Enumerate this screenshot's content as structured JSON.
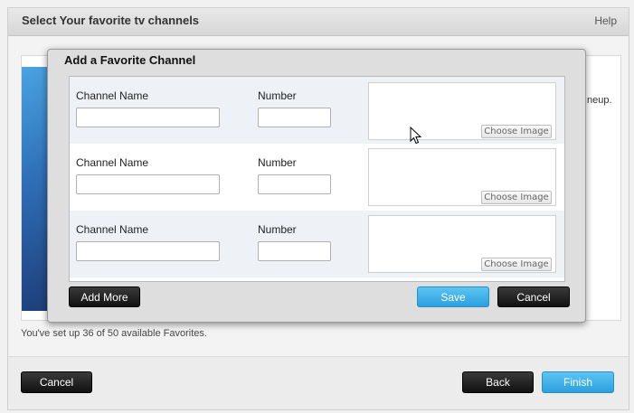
{
  "wizard": {
    "title": "Select Your favorite tv channels",
    "help_label": "Help",
    "side_text": "neup.",
    "status_text": "You've set up 36 of 50 available Favorites.",
    "footer": {
      "cancel_label": "Cancel",
      "back_label": "Back",
      "finish_label": "Finish"
    }
  },
  "modal": {
    "title": "Add a Favorite Channel",
    "rows": [
      {
        "channel_name_label": "Channel Name",
        "number_label": "Number",
        "channel_name_value": "",
        "number_value": "",
        "choose_image_label": "Choose Image"
      },
      {
        "channel_name_label": "Channel Name",
        "number_label": "Number",
        "channel_name_value": "",
        "number_value": "",
        "choose_image_label": "Choose Image"
      },
      {
        "channel_name_label": "Channel Name",
        "number_label": "Number",
        "channel_name_value": "",
        "number_value": "",
        "choose_image_label": "Choose Image"
      }
    ],
    "add_more_label": "Add More",
    "save_label": "Save",
    "cancel_label": "Cancel"
  },
  "colors": {
    "accent_blue": "#2ba0e0",
    "dark_button": "#111111"
  },
  "icons": [
    "mouse-pointer-icon"
  ]
}
